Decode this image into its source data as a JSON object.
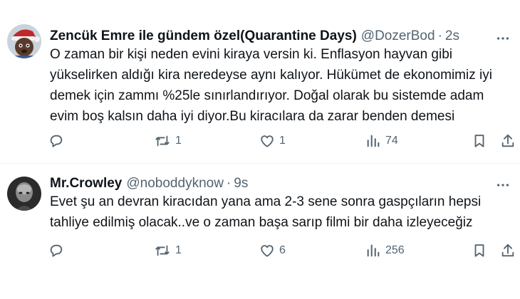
{
  "tweets": [
    {
      "author_name": "Zencük Emre ile gündem özel(Quarantine Days)",
      "handle": "@DozerBod",
      "separator": "·",
      "time": "2s",
      "lines": [
        "O zaman bir kişi neden evini kiraya versin ki. Enflasyon hayvan gibi",
        "yükselirken aldığı kira neredeyse aynı kalıyor. Hükümet de ekonomimiz iyi",
        "demek için zammı %25le sınırlandırıyor. Doğal olarak bu sistemde adam",
        "evim boş kalsın daha iyi diyor.Bu kiracılara da zarar benden demesi"
      ],
      "retweets": "1",
      "likes": "1",
      "views": "74"
    },
    {
      "author_name": "Mr.Crowley",
      "handle": "@noboddyknow",
      "separator": "·",
      "time": "9s",
      "lines": [
        "Evet şu an devran kiracıdan yana ama 2-3 sene sonra gaspçıların hepsi",
        "tahliye edilmiş olacak..ve o zaman başa sarıp filmi bir daha izleyeceğiz"
      ],
      "retweets": "1",
      "likes": "6",
      "views": "256"
    }
  ],
  "icons": {
    "more": "more-dots-icon",
    "reply": "reply-bubble-icon",
    "retweet": "retweet-icon",
    "like": "heart-icon",
    "views": "views-bars-icon",
    "bookmark": "bookmark-icon",
    "share": "share-icon"
  },
  "colors": {
    "text": "#0f1419",
    "secondary": "#536471",
    "divider": "#eff3f4"
  }
}
